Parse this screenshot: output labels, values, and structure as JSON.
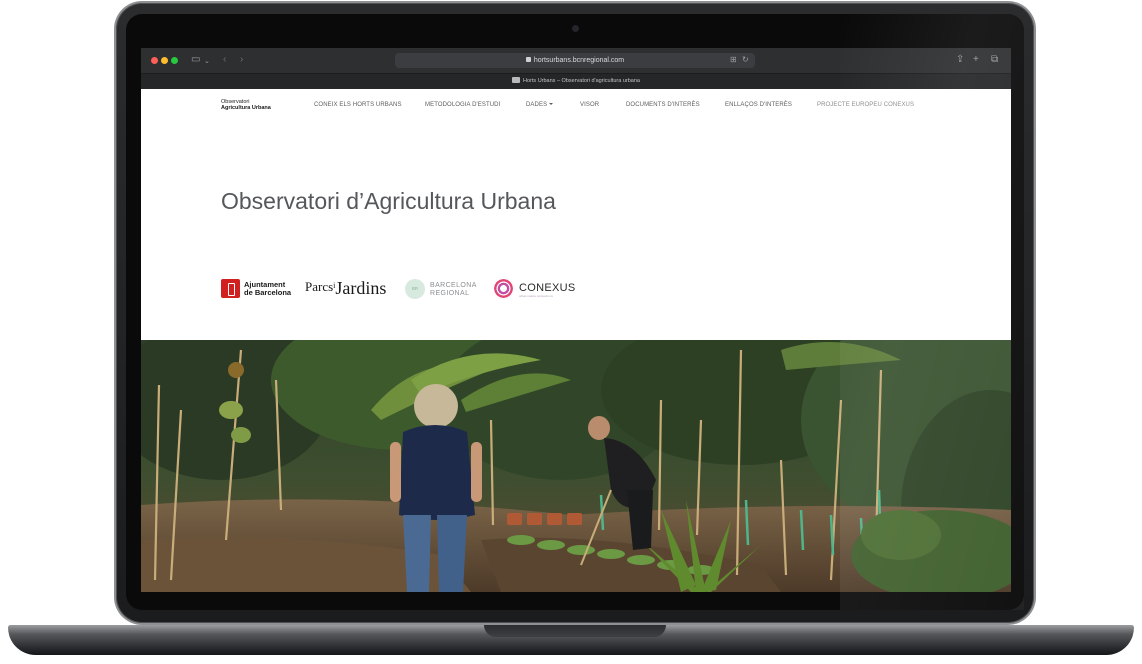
{
  "browser": {
    "url": "hortsurbans.bcnregional.com",
    "tab_title": "Horts Urbans – Observatori d'agricultura urbana"
  },
  "site": {
    "logo_line1": "Observatori",
    "logo_line2": "Agricultura Urbana",
    "nav": [
      {
        "label": "CONEIX ELS HORTS URBANS"
      },
      {
        "label": "METODOLOGIA D'ESTUDI"
      },
      {
        "label": "DADES"
      },
      {
        "label": "VISOR"
      },
      {
        "label": "DOCUMENTS D'INTERÈS"
      },
      {
        "label": "ENLLAÇOS D'INTERÈS"
      },
      {
        "label": "PROJECTE EUROPEU CONEXUS"
      }
    ],
    "hero_title": "Observatori d’Agricultura Urbana"
  },
  "partners": {
    "ajuntament_line1": "Ajuntament",
    "ajuntament_line2": "de Barcelona",
    "parcs_a": "Parcs",
    "parcs_b": "i",
    "parcs_c": "Jardins",
    "bcr_mark": "BR",
    "bcr_line1": "BARCELONA",
    "bcr_line2": "REGIONAL",
    "conexus": "CONEXUS",
    "conexus_sub": "urban nature connects us"
  },
  "colors": {
    "ajuntament_red": "#d0201f",
    "toolbar": "#2e2f31",
    "title_gray": "#55575a"
  }
}
